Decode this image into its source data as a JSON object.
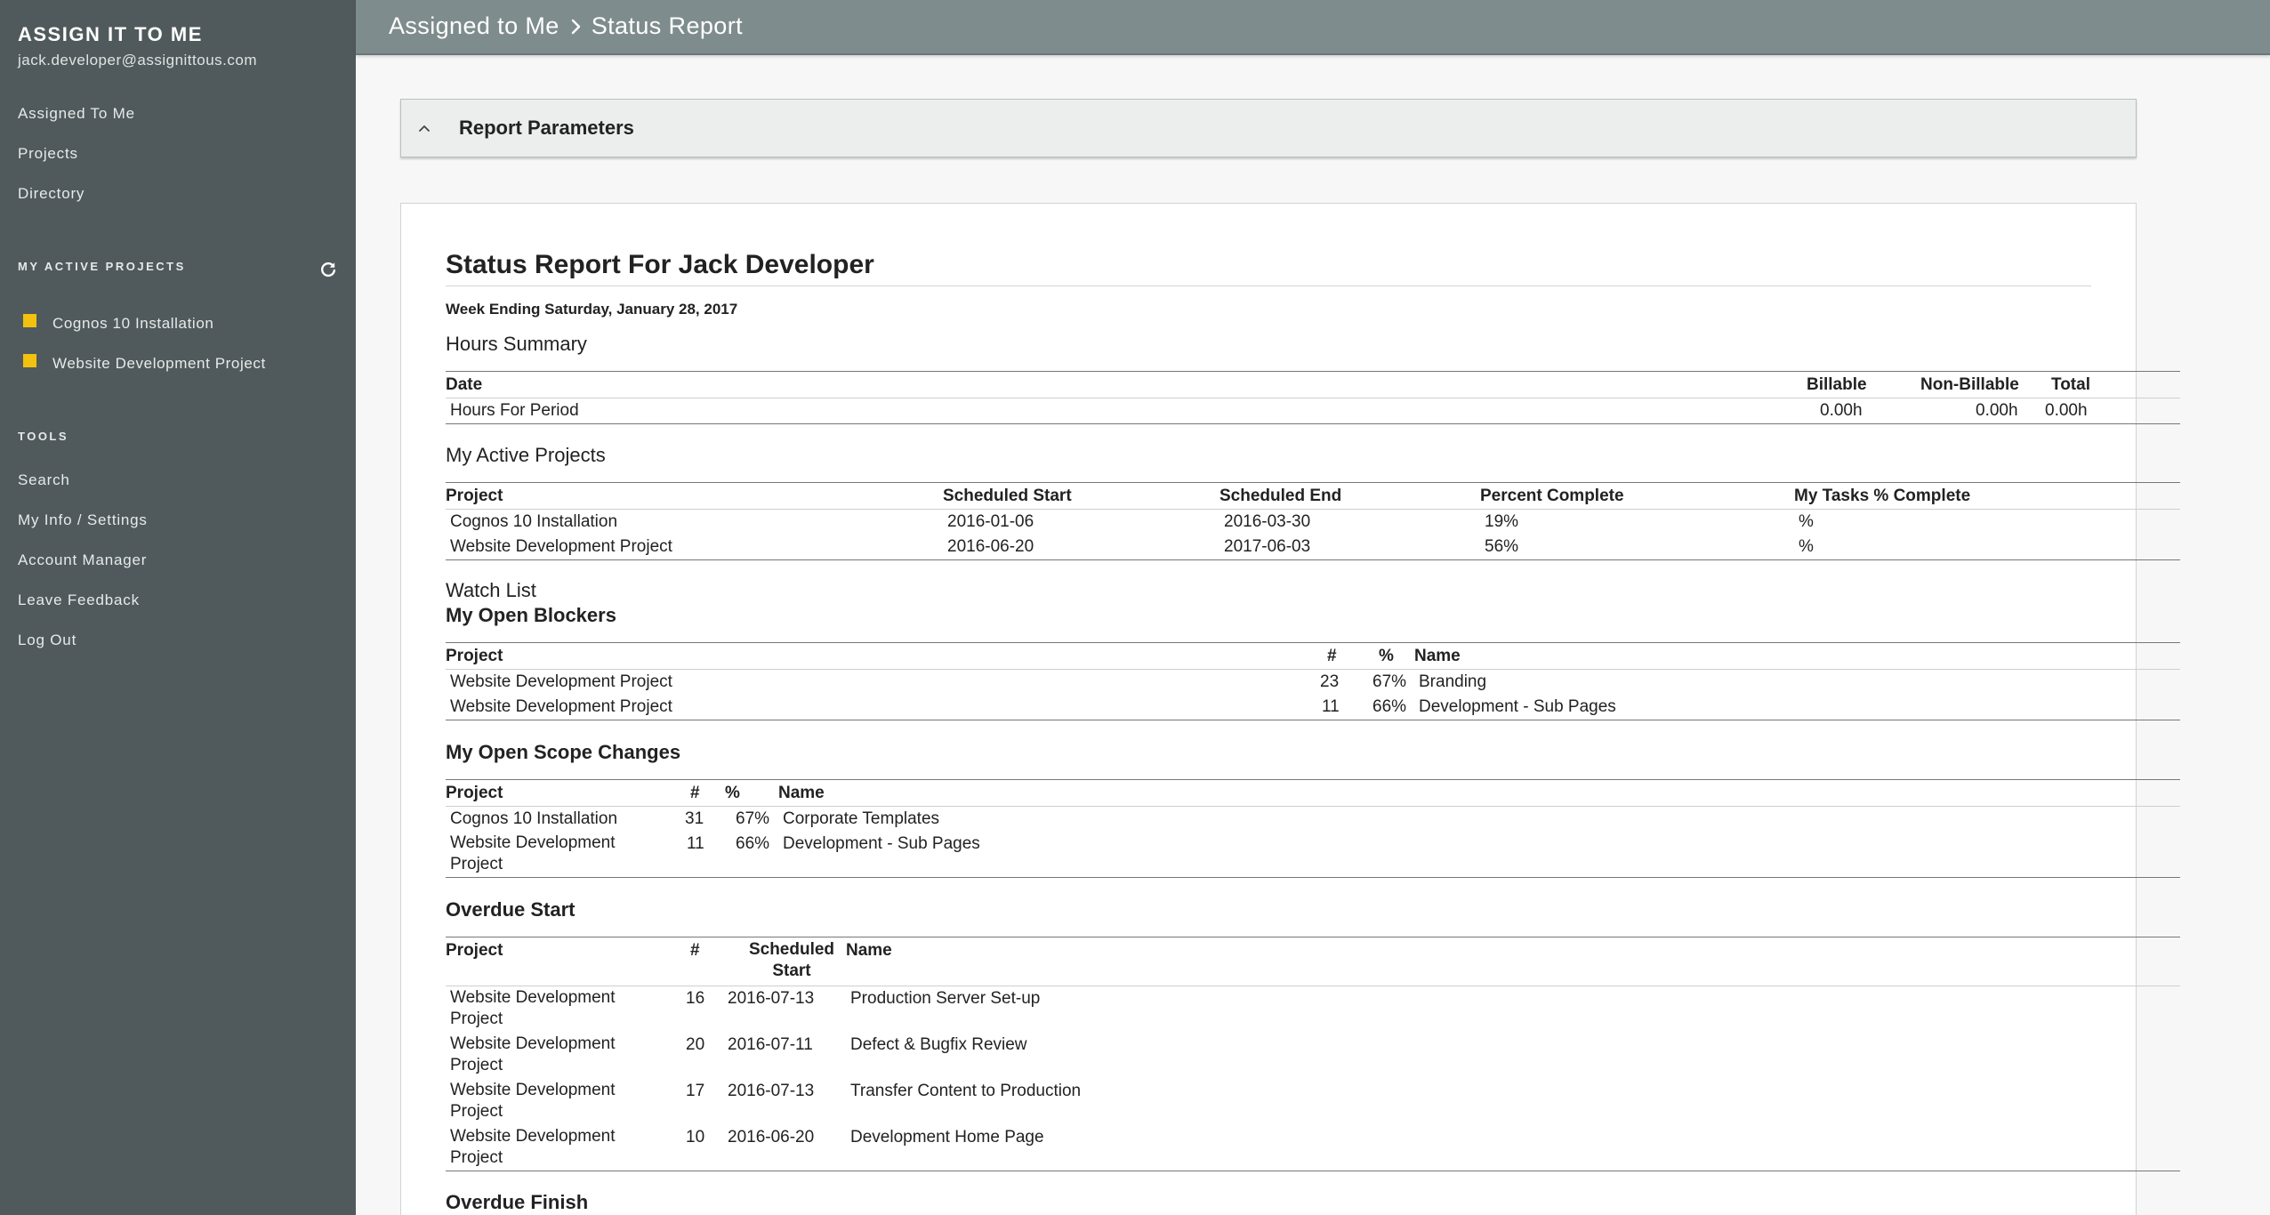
{
  "app": {
    "brand": "ASSIGN IT TO ME",
    "email": "jack.developer@assignittous.com"
  },
  "nav": {
    "assigned": "Assigned To Me",
    "projects": "Projects",
    "directory": "Directory"
  },
  "active_projects": {
    "title": "MY ACTIVE PROJECTS",
    "items": [
      {
        "label": "Cognos 10 Installation",
        "color": "#f2c20f"
      },
      {
        "label": "Website Development Project",
        "color": "#f2c20f"
      }
    ]
  },
  "tools": {
    "title": "TOOLS",
    "search": "Search",
    "settings": "My Info / Settings",
    "account": "Account Manager",
    "feedback": "Leave Feedback",
    "logout": "Log Out"
  },
  "header": {
    "crumb1": "Assigned to Me",
    "crumb2": "Status Report"
  },
  "params": {
    "title": "Report Parameters"
  },
  "report": {
    "title": "Status Report For Jack Developer",
    "week": "Week Ending Saturday, January 28, 2017",
    "hours": {
      "title": "Hours Summary",
      "headers": {
        "date": "Date",
        "billable": "Billable",
        "nonbillable": "Non-Billable",
        "total": "Total"
      },
      "row": {
        "label": "Hours For Period",
        "billable": "0.00h",
        "nonbillable": "0.00h",
        "total": "0.00h"
      }
    },
    "active": {
      "title": "My Active Projects",
      "headers": {
        "project": "Project",
        "start": "Scheduled Start",
        "end": "Scheduled End",
        "pct": "Percent Complete",
        "mytasks": "My Tasks % Complete"
      },
      "rows": [
        {
          "project": "Cognos 10 Installation",
          "start": "2016-01-06",
          "end": "2016-03-30",
          "pct": "19%",
          "mytasks": "%"
        },
        {
          "project": "Website Development Project",
          "start": "2016-06-20",
          "end": "2017-06-03",
          "pct": "56%",
          "mytasks": "%"
        }
      ]
    },
    "watch": {
      "title": "Watch List"
    },
    "blockers": {
      "title": "My Open Blockers",
      "headers": {
        "project": "Project",
        "num": "#",
        "pct": "%",
        "name": "Name"
      },
      "rows": [
        {
          "project": "Website Development Project",
          "num": "23",
          "pct": "67%",
          "name": "Branding"
        },
        {
          "project": "Website Development Project",
          "num": "11",
          "pct": "66%",
          "name": "Development - Sub Pages"
        }
      ]
    },
    "scope": {
      "title": "My Open Scope Changes",
      "headers": {
        "project": "Project",
        "num": "#",
        "pct": "%",
        "name": "Name"
      },
      "rows": [
        {
          "project": "Cognos 10 Installation",
          "num": "31",
          "pct": "67%",
          "name": "Corporate Templates"
        },
        {
          "project": "Website Development Project",
          "num": "11",
          "pct": "66%",
          "name": "Development - Sub Pages"
        }
      ]
    },
    "overdue_start": {
      "title": "Overdue Start",
      "headers": {
        "project": "Project",
        "num": "#",
        "start": "Scheduled Start",
        "name": "Name"
      },
      "rows": [
        {
          "project": "Website Development Project",
          "num": "16",
          "start": "2016-07-13",
          "name": "Production Server Set-up"
        },
        {
          "project": "Website Development Project",
          "num": "20",
          "start": "2016-07-11",
          "name": "Defect & Bugfix Review"
        },
        {
          "project": "Website Development Project",
          "num": "17",
          "start": "2016-07-13",
          "name": "Transfer Content to Production"
        },
        {
          "project": "Website Development Project",
          "num": "10",
          "start": "2016-06-20",
          "name": "Development Home Page"
        }
      ]
    },
    "overdue_finish": {
      "title": "Overdue Finish"
    }
  }
}
